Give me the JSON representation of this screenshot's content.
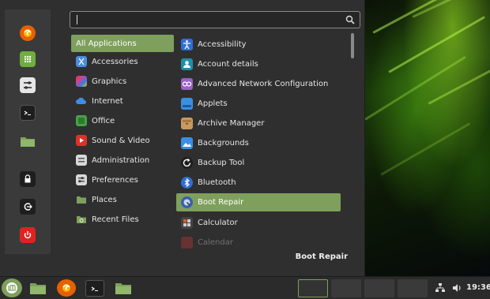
{
  "search": {
    "value": "",
    "placeholder": ""
  },
  "favorites": [
    {
      "name": "firefox-icon",
      "color": "#e66000"
    },
    {
      "name": "software-manager-icon",
      "color": "#6fae3f"
    },
    {
      "name": "settings-icon",
      "color": "#e6e6e6"
    },
    {
      "name": "terminal-icon",
      "color": "#1e1e1e"
    },
    {
      "name": "files-icon",
      "color": "#7ea05c"
    }
  ],
  "session": [
    {
      "name": "lock-screen-icon"
    },
    {
      "name": "logout-icon"
    },
    {
      "name": "shutdown-icon",
      "color": "#e02222"
    }
  ],
  "categories": [
    {
      "label": "All Applications",
      "icon": "all-apps",
      "selected": true
    },
    {
      "label": "Accessories",
      "icon": "scissors-icon",
      "color": "#4a8ce0"
    },
    {
      "label": "Graphics",
      "icon": "graphics-icon",
      "color": "#d0428e"
    },
    {
      "label": "Internet",
      "icon": "cloud-icon",
      "color": "#3d8ee6"
    },
    {
      "label": "Office",
      "icon": "office-icon",
      "color": "#4aa04a"
    },
    {
      "label": "Sound & Video",
      "icon": "play-icon",
      "color": "#e0302a"
    },
    {
      "label": "Administration",
      "icon": "admin-icon",
      "color": "#d8d8d8"
    },
    {
      "label": "Preferences",
      "icon": "preferences-icon",
      "color": "#d8d8d8"
    },
    {
      "label": "Places",
      "icon": "folder-icon",
      "color": "#7ea05c"
    },
    {
      "label": "Recent Files",
      "icon": "recent-folder-icon",
      "color": "#7ea05c"
    }
  ],
  "apps": [
    {
      "label": "Accessibility",
      "icon": "accessibility-icon",
      "color": "#2f6ed6"
    },
    {
      "label": "Account details",
      "icon": "account-icon",
      "color": "#1f8fa8"
    },
    {
      "label": "Advanced Network Configuration",
      "icon": "network-icon",
      "color": "#9a62c6"
    },
    {
      "label": "Applets",
      "icon": "applets-icon",
      "color": "#3a8fe0"
    },
    {
      "label": "Archive Manager",
      "icon": "archive-icon",
      "color": "#c79a5e"
    },
    {
      "label": "Backgrounds",
      "icon": "backgrounds-icon",
      "color": "#3a8fe0"
    },
    {
      "label": "Backup Tool",
      "icon": "backup-icon",
      "color": "#1e1e1e"
    },
    {
      "label": "Bluetooth",
      "icon": "bluetooth-icon",
      "color": "#2f6ed6"
    },
    {
      "label": "Boot Repair",
      "icon": "boot-repair-icon",
      "color": "#3b5fb0",
      "selected": true
    },
    {
      "label": "Calculator",
      "icon": "calculator-icon",
      "color": "#444444"
    },
    {
      "label": "Calendar",
      "icon": "calendar-icon",
      "color": "#cc3a3a",
      "faded": true
    }
  ],
  "description": {
    "title": "Boot Repair"
  },
  "taskbar": {
    "menu_icon": "mint-menu-icon",
    "launchers": [
      "files-icon",
      "firefox-icon",
      "terminal-icon",
      "files-icon"
    ],
    "workspaces": 4,
    "clock": "19:36"
  },
  "colors": {
    "accent": "#7ea05c",
    "menu_bg": "#2f2f2f",
    "panel_bg": "#2b2b2b"
  }
}
